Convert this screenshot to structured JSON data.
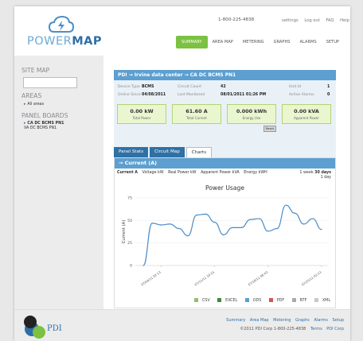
{
  "brand": {
    "logo_power": "POWER",
    "logo_map": "MAP"
  },
  "header": {
    "phone": "1-800-225-4838",
    "links": [
      "settings",
      "Log out",
      "FAQ",
      "Help"
    ],
    "nav": [
      "SUMMARY",
      "AREA MAP",
      "METERING",
      "GRAPHS",
      "ALARMS",
      "SETUP"
    ],
    "active_nav": "SUMMARY"
  },
  "sidebar": {
    "site_map_heading": "SITE MAP",
    "search_value": "",
    "areas_heading": "AREAS",
    "areas_item": "All areas",
    "panel_boards_heading": "PANEL BOARDS",
    "panel_item": "CA DC BCMS PN1",
    "panel_sub": "VA DC BCMS PN1"
  },
  "breadcrumb": "PDI → Irvine data center → CA DC BCMS PN1",
  "info": {
    "device_type_label": "Device Type",
    "device_type": "BCMS",
    "circuit_count_label": "Circuit Count",
    "circuit_count": "42",
    "unit_id_label": "Unit Id",
    "unit_id": "1",
    "online_since_label": "Online Since",
    "online_since": "04/08/2011",
    "last_monitored_label": "Last Monitored",
    "last_monitored": "08/01/2011 01:26 PM",
    "active_alarms_label": "Active Alarms",
    "active_alarms": "0"
  },
  "stats": [
    {
      "value": "0.00 kW",
      "label": "Total Power"
    },
    {
      "value": "61.60 A",
      "label": "Total Current"
    },
    {
      "value": "0.000 kWh",
      "label": "Energy Use"
    },
    {
      "value": "0.00 kVA",
      "label": "Apparent Power"
    }
  ],
  "reset_label": "Reset",
  "tabs": [
    "Panel Stats",
    "Circuit Map",
    "Charts"
  ],
  "active_tab": "Charts",
  "section_title": "→ Current (A)",
  "metrics": [
    "Current A",
    "Voltage kW",
    "Real Power kW",
    "Apparent Power kVA",
    "Energy kWH"
  ],
  "active_metric": "Current A",
  "ranges": [
    "1 week",
    "30 days",
    "1 day"
  ],
  "active_range": "30 days",
  "export": [
    "CSV",
    "EXCEL",
    "ODS",
    "PDF",
    "RTF",
    "XML"
  ],
  "footer": {
    "links": [
      "Summary",
      "Area Map",
      "Metering",
      "Graphs",
      "Alarms",
      "Setup"
    ],
    "copyright": "©2011 PDI Corp   1-800-225-4838",
    "terms": "Terms",
    "corp": "PDI Corp",
    "footer_logo_text": "PDI"
  },
  "colors": {
    "accent_blue": "#5c9fd0",
    "dark_blue": "#2f70a5",
    "nav_green": "#7cc142",
    "stat_bg": "#eaf6cf",
    "line": "#4a8cc8"
  },
  "icons": [
    "cloud-bolt-icon",
    "arrow-right-icon",
    "csv-icon",
    "excel-icon",
    "ods-icon",
    "pdf-icon",
    "rtf-icon",
    "xml-icon"
  ],
  "chart_data": {
    "type": "line",
    "title": "Power Usage",
    "ylabel": "Current (A)",
    "xlabel": "",
    "ylim": [
      0,
      75
    ],
    "yticks": [
      0,
      25,
      50,
      75
    ],
    "xticks": [
      "07/04/11 02:13",
      "07/11/11 10:15",
      "07/18/11 06:43",
      "07/25/11 02:13"
    ],
    "grid": true,
    "series": [
      {
        "x": [
          "07/01",
          "07/03",
          "07/05",
          "07/06",
          "07/08",
          "07/09",
          "07/10",
          "07/12",
          "07/13",
          "07/14",
          "07/16",
          "07/17",
          "07/19",
          "07/20",
          "07/21",
          "07/23",
          "07/24",
          "07/26",
          "07/27",
          "07/29",
          "07/30"
        ],
        "values": [
          0,
          47,
          45,
          46,
          41,
          33,
          56,
          57,
          48,
          34,
          42,
          42,
          51,
          52,
          38,
          41,
          67,
          58,
          46,
          52,
          40
        ]
      }
    ]
  }
}
